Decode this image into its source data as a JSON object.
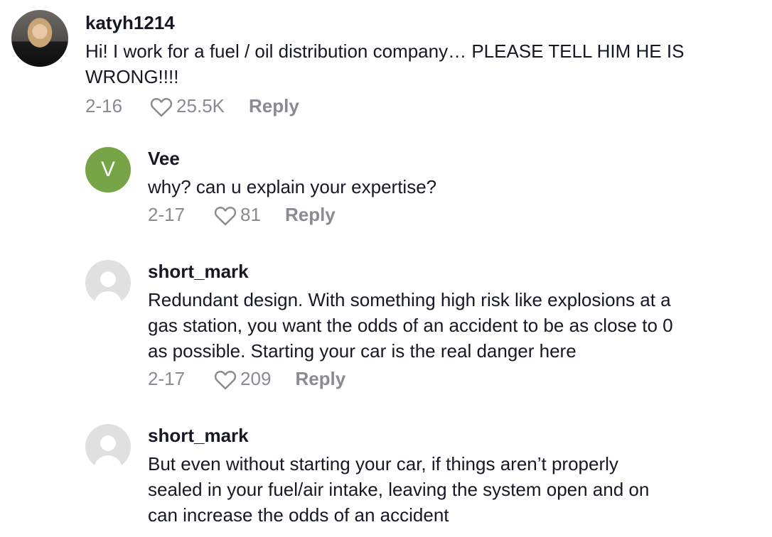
{
  "comments": [
    {
      "username": "katyh1214",
      "avatar": "photo-avatar",
      "text_lines": [
        "Hi! I work for a fuel / oil distribution company… PLEASE TELL HIM HE IS",
        "WRONG!!!!"
      ],
      "date": "2-16",
      "likes": "25.5K",
      "reply_label": "Reply"
    },
    {
      "username": "Vee",
      "avatar_initial": "V",
      "avatar_color": "#76a447",
      "text_lines": [
        "why? can u explain your expertise?"
      ],
      "date": "2-17",
      "likes": "81",
      "reply_label": "Reply"
    },
    {
      "username": "short_mark",
      "avatar": "default-avatar",
      "text_lines": [
        "Redundant design. With something high risk like explosions at a",
        "gas station, you want the odds of an accident to be as close to 0",
        "as possible. Starting your car is the real danger here"
      ],
      "date": "2-17",
      "likes": "209",
      "reply_label": "Reply"
    },
    {
      "username": "short_mark",
      "avatar": "default-avatar",
      "text_lines": [
        "But even without starting your car, if things aren’t properly",
        "sealed in your fuel/air intake, leaving the system open and on",
        "can increase the odds of an accident"
      ]
    }
  ],
  "icons": {
    "like": "heart-outline-icon"
  }
}
